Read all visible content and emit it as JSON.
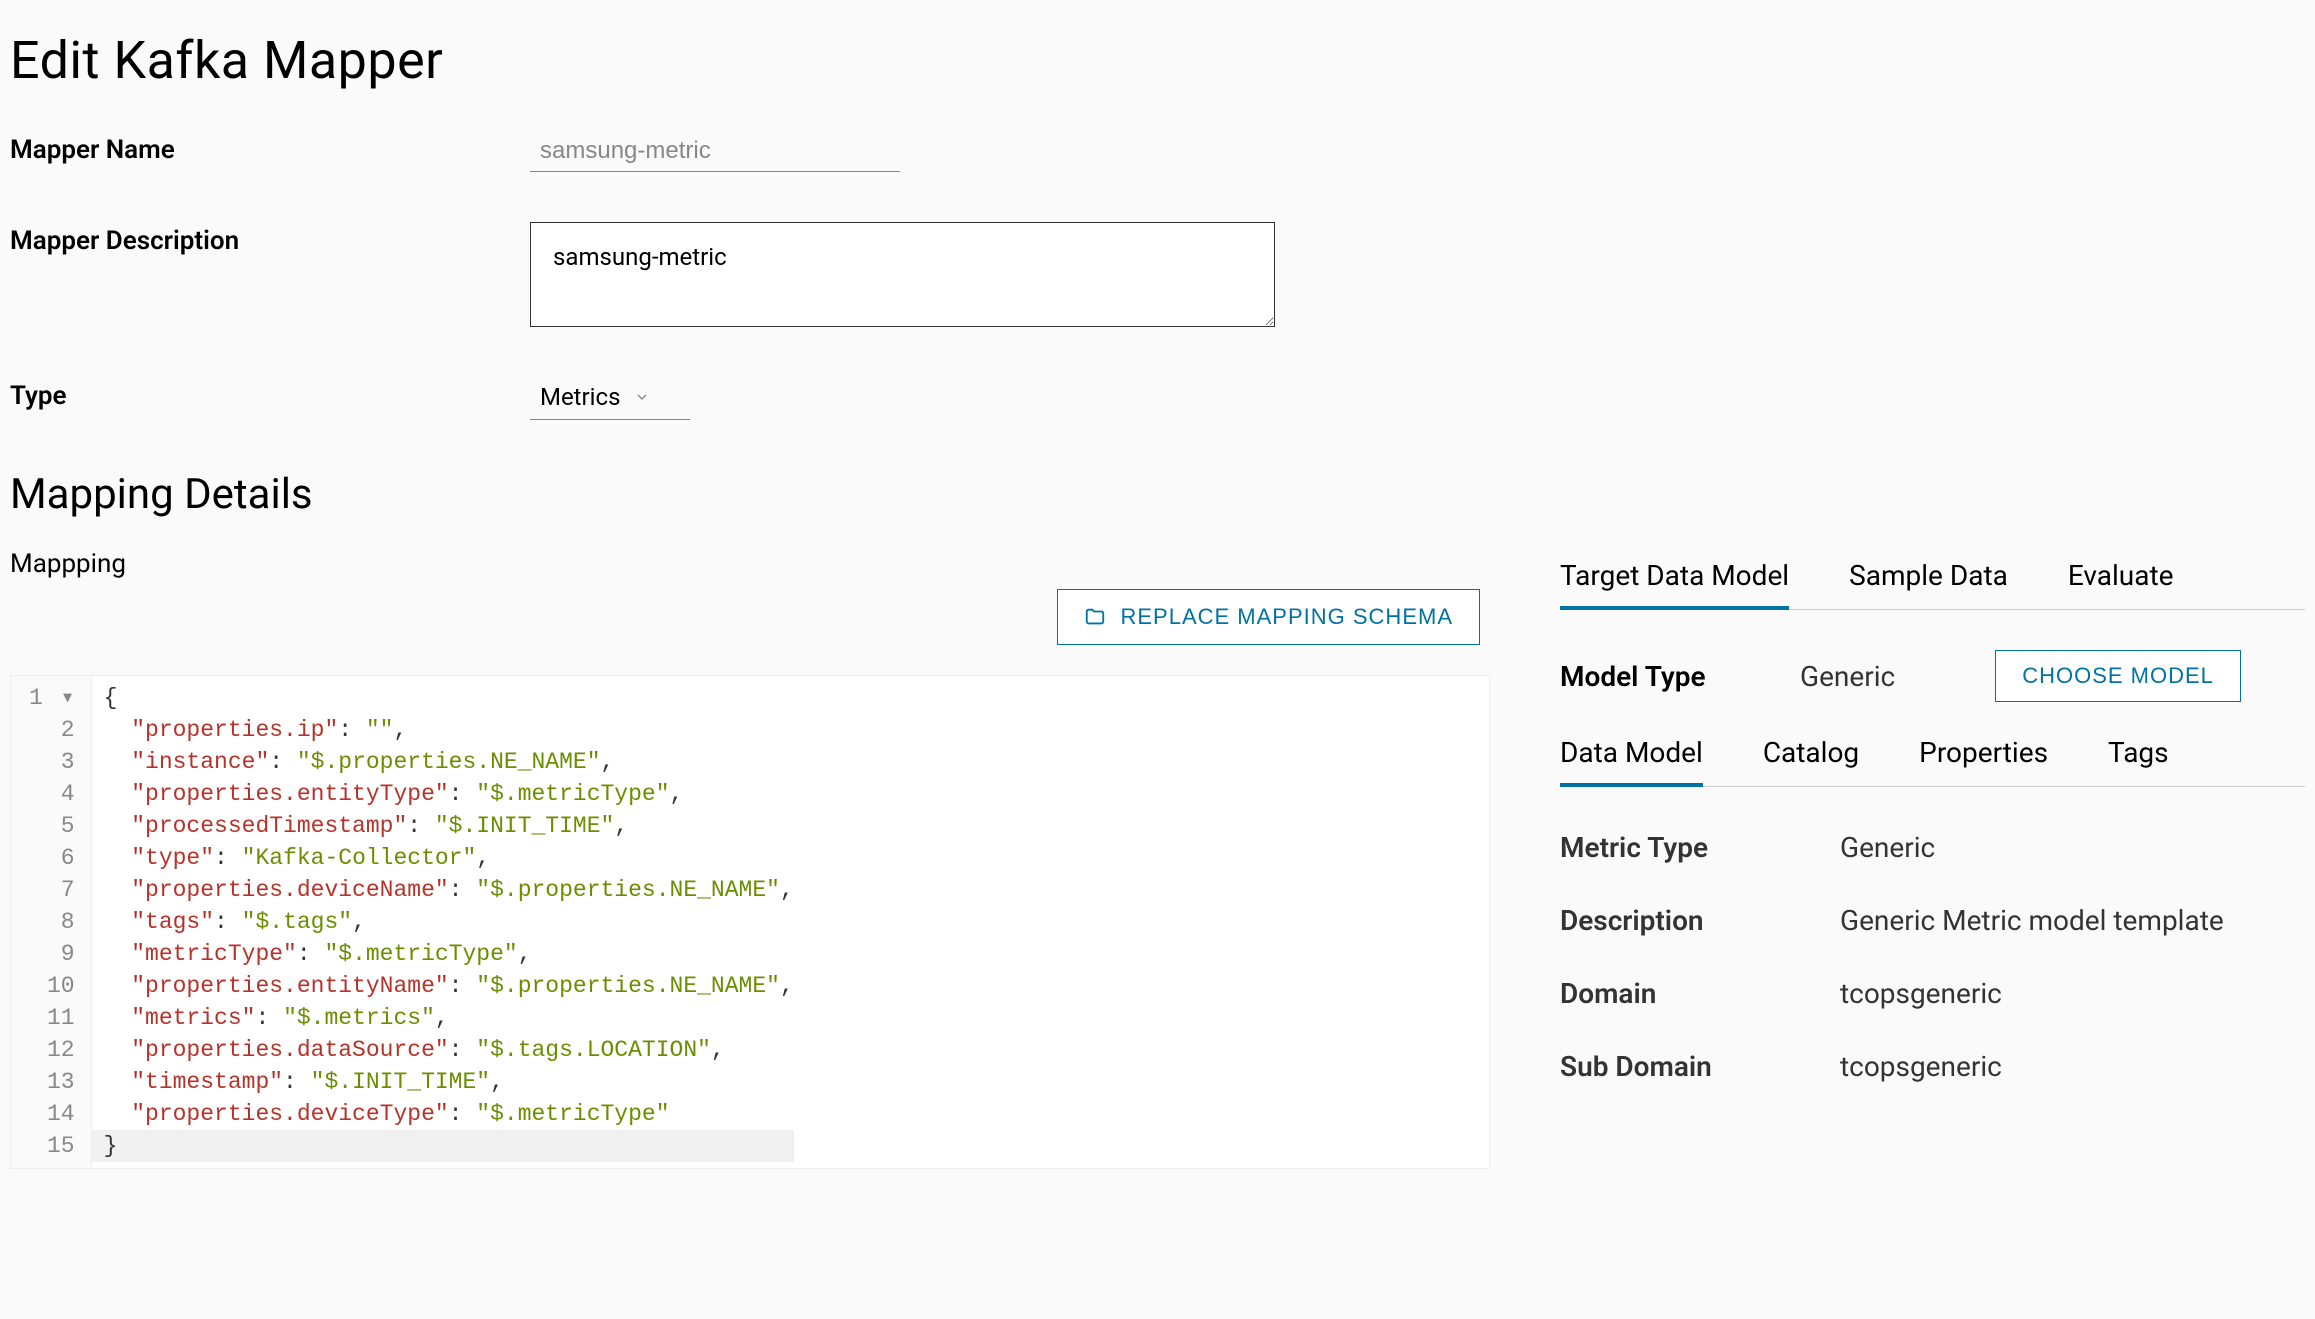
{
  "page_title": "Edit Kafka Mapper",
  "form": {
    "name_label": "Mapper Name",
    "name_value": "samsung-metric",
    "desc_label": "Mapper Description",
    "desc_value": "samsung-metric",
    "type_label": "Type",
    "type_value": "Metrics"
  },
  "section": {
    "title": "Mapping Details",
    "sub_label": "Mappping",
    "replace_btn": "REPLACE MAPPING SCHEMA"
  },
  "code_lines": [
    {
      "kind": "open",
      "text": "{"
    },
    {
      "kind": "kv",
      "key": "properties.ip",
      "val": "",
      "comma": true
    },
    {
      "kind": "kv",
      "key": "instance",
      "val": "$.properties.NE_NAME",
      "comma": true
    },
    {
      "kind": "kv",
      "key": "properties.entityType",
      "val": "$.metricType",
      "comma": true
    },
    {
      "kind": "kv",
      "key": "processedTimestamp",
      "val": "$.INIT_TIME",
      "comma": true
    },
    {
      "kind": "kv",
      "key": "type",
      "val": "Kafka-Collector",
      "comma": true
    },
    {
      "kind": "kv",
      "key": "properties.deviceName",
      "val": "$.properties.NE_NAME",
      "comma": true
    },
    {
      "kind": "kv",
      "key": "tags",
      "val": "$.tags",
      "comma": true
    },
    {
      "kind": "kv",
      "key": "metricType",
      "val": "$.metricType",
      "comma": true
    },
    {
      "kind": "kv",
      "key": "properties.entityName",
      "val": "$.properties.NE_NAME",
      "comma": true
    },
    {
      "kind": "kv",
      "key": "metrics",
      "val": "$.metrics",
      "comma": true
    },
    {
      "kind": "kv",
      "key": "properties.dataSource",
      "val": "$.tags.LOCATION",
      "comma": true
    },
    {
      "kind": "kv",
      "key": "timestamp",
      "val": "$.INIT_TIME",
      "comma": true
    },
    {
      "kind": "kv",
      "key": "properties.deviceType",
      "val": "$.metricType",
      "comma": false
    },
    {
      "kind": "close",
      "text": "}"
    }
  ],
  "tabs": {
    "items": [
      "Target Data Model",
      "Sample Data",
      "Evaluate"
    ],
    "active": 0
  },
  "model": {
    "type_label": "Model Type",
    "type_value": "Generic",
    "choose_btn": "CHOOSE MODEL"
  },
  "subtabs": {
    "items": [
      "Data Model",
      "Catalog",
      "Properties",
      "Tags"
    ],
    "active": 0
  },
  "fields": [
    {
      "label": "Metric Type",
      "value": "Generic"
    },
    {
      "label": "Description",
      "value": "Generic Metric model template"
    },
    {
      "label": "Domain",
      "value": "tcopsgeneric"
    },
    {
      "label": "Sub Domain",
      "value": "tcopsgeneric"
    }
  ]
}
